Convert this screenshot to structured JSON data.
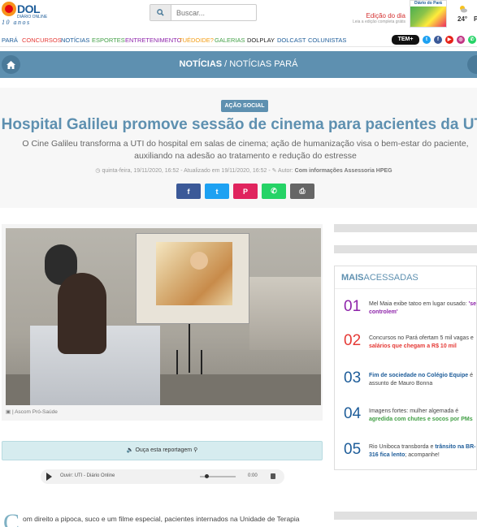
{
  "header": {
    "logo": {
      "name": "DOL",
      "subtitle": "DIÁRIO ONLINE",
      "years": "10 anos"
    },
    "search": {
      "placeholder": "Buscar..."
    },
    "edition": {
      "title": "Edição do dia",
      "subtitle": "Leia a edição completa grátis"
    },
    "newspaper_title": "Diário do Pará",
    "weather": {
      "temp": "24°",
      "city": "P"
    }
  },
  "nav": {
    "items": [
      {
        "label": "PARÁ",
        "color": "#1d5c99"
      },
      {
        "label": "CONCURSOS",
        "color": "#e53935"
      },
      {
        "label": "NOTÍCIAS",
        "color": "#1d5c99"
      },
      {
        "label": "ESPORTES",
        "color": "#43a047"
      },
      {
        "label": "ENTRETENIMENTO",
        "color": "#8e24aa"
      },
      {
        "label": "TUÉDOIDE?",
        "color": "#f39c12"
      },
      {
        "label": "GALERIAS",
        "color": "#43a047"
      },
      {
        "label": "DOLPLAY",
        "color": "#222222"
      },
      {
        "label": "DOLCAST",
        "color": "#1d5c99"
      },
      {
        "label": "COLUNISTAS",
        "color": "#1d5c99"
      }
    ],
    "tem_label": "TEM+",
    "social_icons": [
      "twitter-icon",
      "facebook-icon",
      "youtube-icon",
      "instagram-icon",
      "whatsapp-icon",
      "shield-icon"
    ]
  },
  "section_bar": {
    "primary": "NOTÍCIAS",
    "separator": " / ",
    "secondary": "NOTÍCIAS PARÁ"
  },
  "article": {
    "tag": "AÇÃO SOCIAL",
    "title": "Hospital Galileu promove sessão de cinema para pacientes da UTI",
    "subtitle": "O Cine Galileu transforma a UTI do hospital em salas de cinema; ação de humanização visa o bem-estar do paciente, auxiliando na adesão ao tratamento e redução do estresse",
    "meta": {
      "published": "quinta-feira, 19/11/2020, 16:52",
      "updated": "Atualizado em 19/11/2020, 16:52",
      "author_prefix": "Autor:",
      "author": "Com informações Assessoria HPEG"
    },
    "share_buttons": [
      "facebook",
      "twitter",
      "pinterest",
      "whatsapp",
      "print"
    ],
    "photo_caption": "| Ascom Pró-Saúde",
    "audio_label": "Ouça esta reportagem",
    "player": {
      "label": "Ouvir:",
      "source": "UTI - Diário Online",
      "time": "0:00"
    },
    "body_drop_cap": "C",
    "body_text": "om direito a pipoca, suco e um filme especial, pacientes internados na Unidade de Terapia"
  },
  "most_read": {
    "heading_bold": "MAIS",
    "heading_rest": "ACESSADAS",
    "items": [
      {
        "num": "01",
        "color": "#8e24aa",
        "pre": "Mel Maia exibe tatoo em lugar ousado: ",
        "hl": "'se controlem'",
        "post": ""
      },
      {
        "num": "02",
        "color": "#e53935",
        "pre": "Concursos no Pará ofertam 5 mil vagas e ",
        "hl": "salários que chegam a R$ 10 mil",
        "post": ""
      },
      {
        "num": "03",
        "color": "#1d5c99",
        "pre": "",
        "hl": "Fim de sociedade no Colégio Equipe",
        "post": " é assunto de Mauro Bonna"
      },
      {
        "num": "04",
        "color": "#1d5c99",
        "pre": "Imagens fortes: mulher algemada é ",
        "hl": "agredida com chutes e socos por PMs",
        "post": ""
      },
      {
        "num": "05",
        "color": "#1d5c99",
        "pre": "Rio Uniboca transborda e ",
        "hl": "trânsito na BR-316 fica lento",
        "post": "; acompanhe!"
      }
    ]
  }
}
